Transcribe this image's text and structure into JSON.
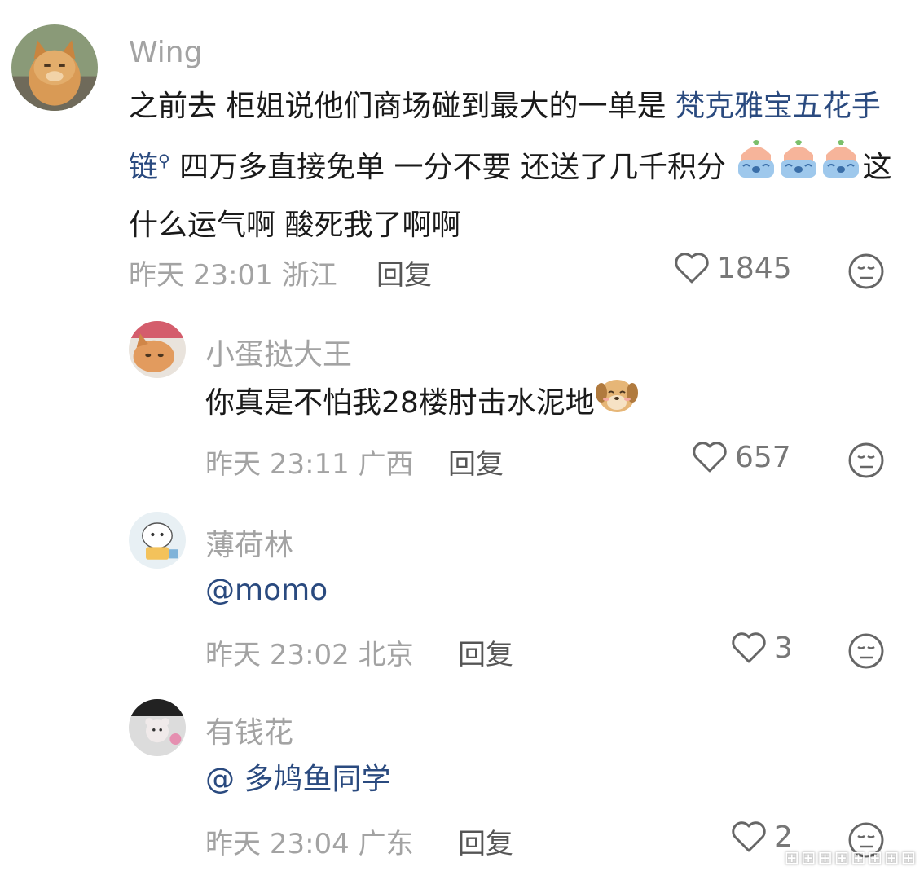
{
  "comments": [
    {
      "name": "Wing",
      "text_a": "之前去 柜姐说他们商场碰到最大的一单是 ",
      "link": "梵克雅宝五花手链",
      "text_b": " 四万多直接免单 一分不要 还送了几千积分",
      "text_c": "这什么运气啊 酸死我了啊啊",
      "date": "昨天",
      "time": "23:01",
      "location": "浙江",
      "reply": "回复",
      "likes": "1845"
    },
    {
      "name": "小蛋挞大王",
      "text": "你真是不怕我28楼肘击水泥地",
      "date": "昨天",
      "time": "23:11",
      "location": "广西",
      "reply": "回复",
      "likes": "657"
    },
    {
      "name": "薄荷林",
      "text": "@momo",
      "date": "昨天",
      "time": "23:02",
      "location": "北京",
      "reply": "回复",
      "likes": "3"
    },
    {
      "name": "有钱花",
      "text": "@ 多鸠鱼同学",
      "date": "昨天",
      "time": "23:04",
      "location": "广东",
      "reply": "回复",
      "likes": "2"
    }
  ],
  "watermark": "⊞⊞⊞⊞⊞⊞⊞⊞"
}
